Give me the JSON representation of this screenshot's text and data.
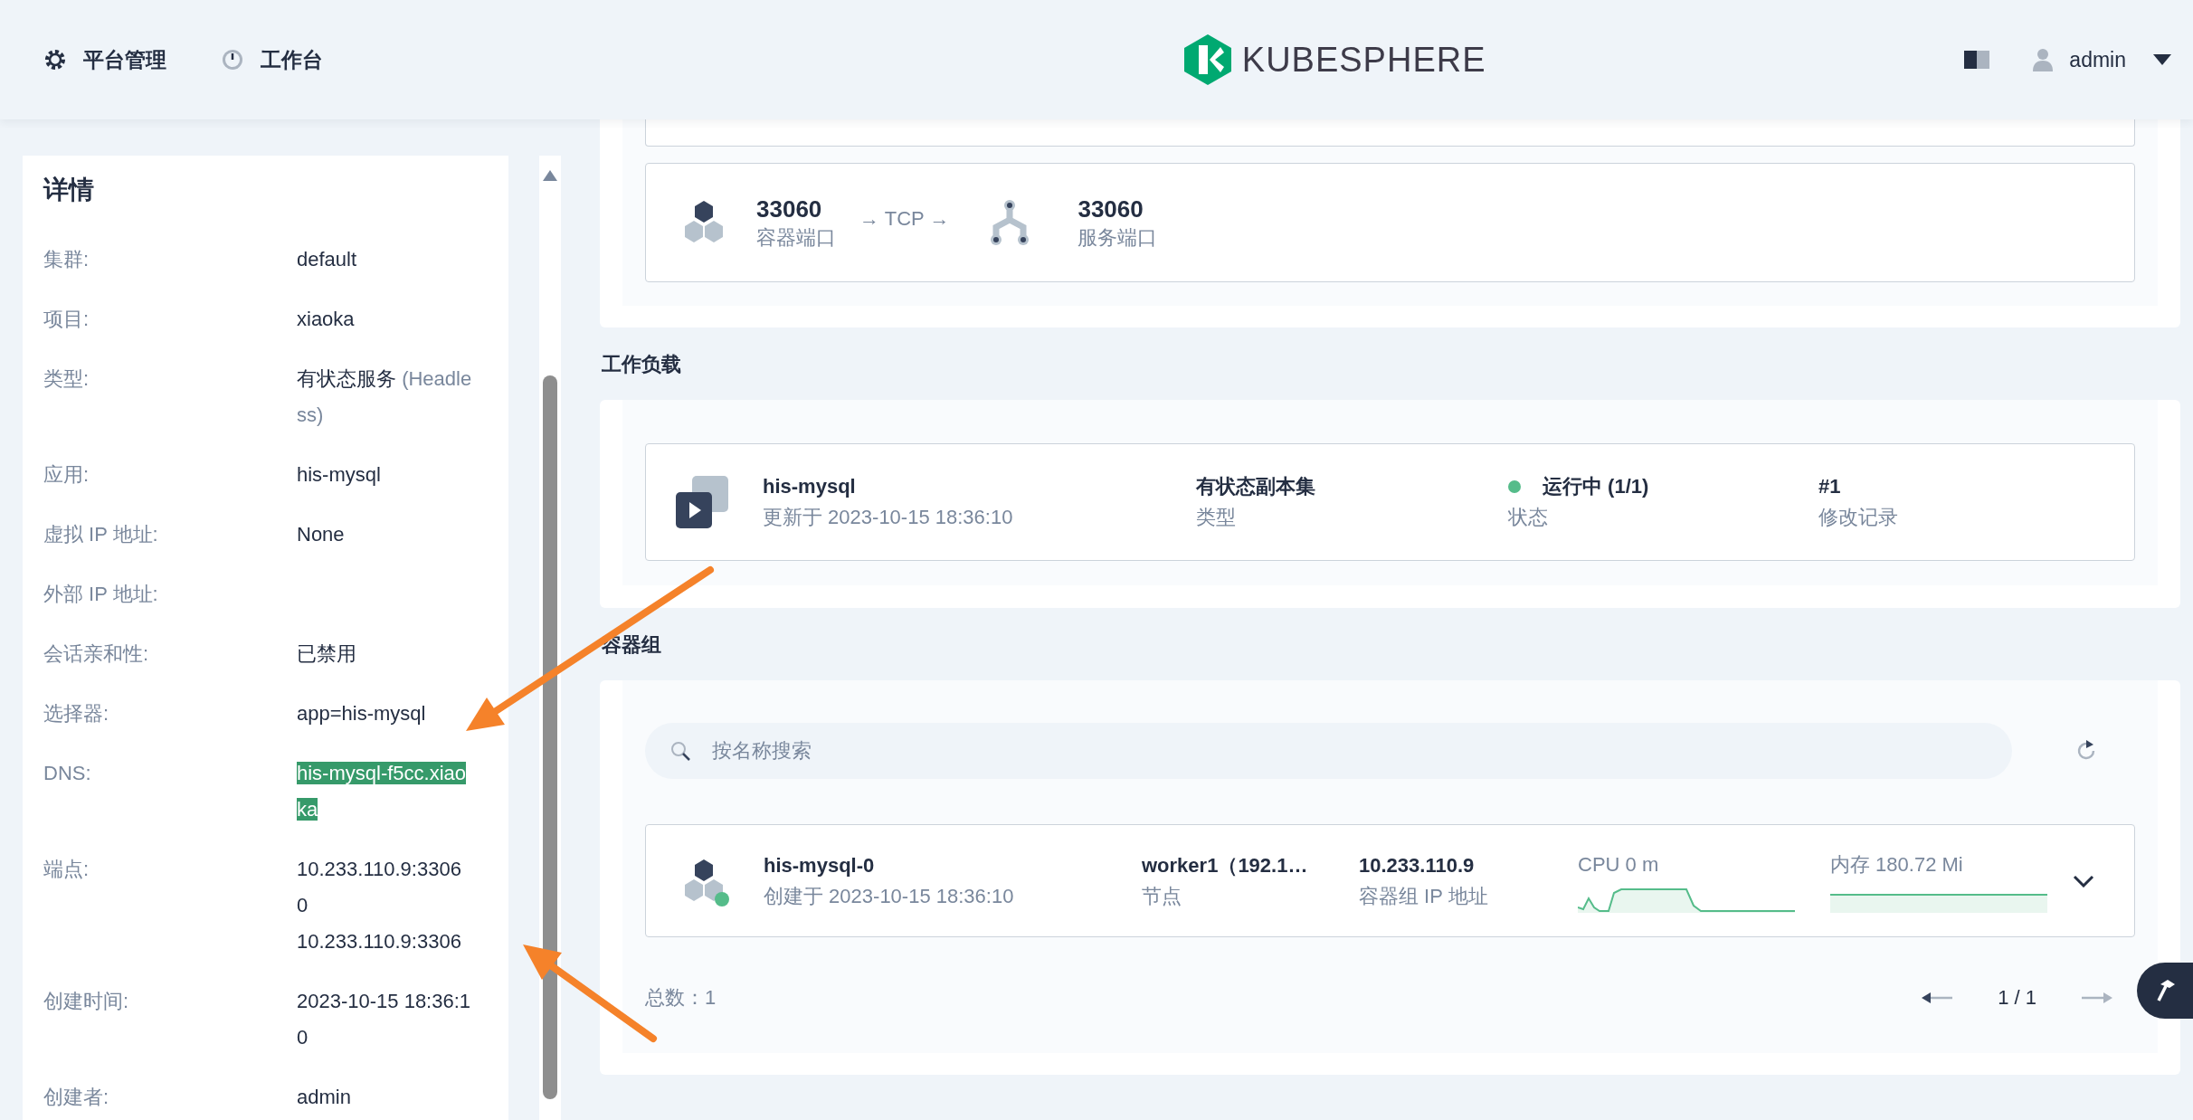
{
  "header": {
    "nav": [
      {
        "kind": "gear",
        "label": "平台管理"
      },
      {
        "kind": "dashboard",
        "label": "工作台"
      }
    ],
    "logo": "KUBESPHERE",
    "user": "admin"
  },
  "details": {
    "title": "详情",
    "rows": [
      {
        "label": "集群:",
        "value": "default"
      },
      {
        "label": "项目:",
        "value": "xiaoka"
      },
      {
        "label": "类型:",
        "value": "有状态服务",
        "note": "(Headless)"
      },
      {
        "label": "应用:",
        "value": "his-mysql"
      },
      {
        "label": "虚拟 IP 地址:",
        "value": "None"
      },
      {
        "label": "外部 IP 地址:"
      },
      {
        "label": "会话亲和性:",
        "value": "已禁用"
      },
      {
        "label": "选择器:",
        "value": "app=his-mysql"
      },
      {
        "label": "DNS:",
        "value": "his-mysql-f5cc.xiaoka",
        "highlighted": true
      },
      {
        "label": "端点:",
        "lines": [
          "10.233.110.9:33060",
          "10.233.110.9:3306"
        ]
      },
      {
        "label": "创建时间:",
        "value": "2023-10-15 18:36:10"
      },
      {
        "label": "创建者:",
        "value": "admin"
      }
    ]
  },
  "ports": {
    "container_port": "33060",
    "container_label": "容器端口",
    "protocol": "→ TCP →",
    "service_port": "33060",
    "service_label": "服务端口"
  },
  "workloads": {
    "heading": "工作负载",
    "items": [
      {
        "name": "his-mysql",
        "updated": "更新于 2023-10-15 18:36:10",
        "type": "有状态副本集",
        "type_label": "类型",
        "status": "运行中 (1/1)",
        "status_label": "状态",
        "running": true,
        "revision": "#1",
        "revision_label": "修改记录"
      }
    ]
  },
  "pods": {
    "heading": "容器组",
    "search": {
      "placeholder": "按名称搜索"
    },
    "items": [
      {
        "name": "his-mysql-0",
        "created": "创建于 2023-10-15 18:36:10",
        "node": "worker1（192.1…",
        "node_label": "节点",
        "ip": "10.233.110.9",
        "ip_label": "容器组 IP 地址",
        "cpu": "CPU 0 m",
        "memory": "内存 180.72 Mi",
        "running": true
      }
    ],
    "total": "总数：1",
    "page": "1 / 1"
  }
}
